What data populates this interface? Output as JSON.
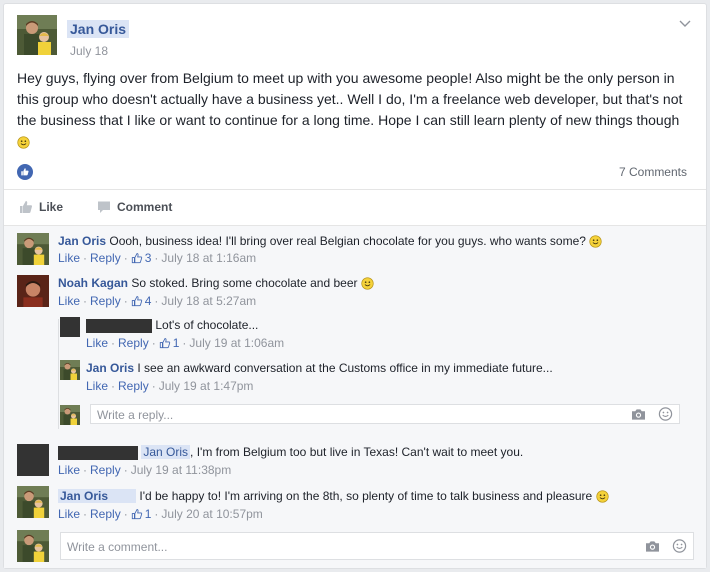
{
  "post": {
    "author": "Jan Oris",
    "date": "July 18",
    "text": "Hey guys, flying over from Belgium to meet up with you awesome people! Also might be the only person in this group who doesn't actually have a business yet.. Well I do, I'm a freelance web developer, but that's not the business that I like or want to continue for a long time. Hope I can still learn plenty of new things though",
    "comments_count": "7 Comments"
  },
  "actions": {
    "like": "Like",
    "comment": "Comment"
  },
  "comments": [
    {
      "author": "Jan Oris",
      "text": "Oooh, business idea! I'll bring over real Belgian chocolate for you guys. who wants some?",
      "like": "Like",
      "reply": "Reply",
      "likes": "3",
      "time": "July 18 at 1:16am"
    },
    {
      "author": "Noah Kagan",
      "text": "So stoked. Bring some chocolate and beer",
      "like": "Like",
      "reply": "Reply",
      "likes": "4",
      "time": "July 18 at 5:27am"
    },
    {
      "author": "",
      "text": "Lot's of chocolate...",
      "like": "Like",
      "reply": "Reply",
      "likes": "1",
      "time": "July 19 at 1:06am"
    },
    {
      "author": "Jan Oris",
      "text": "I see an awkward conversation at the Customs office in my immediate future...",
      "like": "Like",
      "reply": "Reply",
      "time": "July 19 at 1:47pm"
    },
    {
      "author": "",
      "mention": "Jan Oris",
      "text": ", I'm from Belgium too but live in Texas! Can't wait to meet you.",
      "like": "Like",
      "reply": "Reply",
      "time": "July 19 at 11:38pm"
    },
    {
      "author": "Jan Oris",
      "text": "I'd be happy to! I'm arriving on the 8th, so plenty of time to talk business and pleasure",
      "like": "Like",
      "reply": "Reply",
      "likes": "1",
      "time": "July 20 at 10:57pm"
    }
  ],
  "reply_placeholder": "Write a reply...",
  "comment_placeholder": "Write a comment...",
  "colors": {
    "link": "#365899",
    "accent": "#4267b2",
    "muted": "#90949c"
  }
}
